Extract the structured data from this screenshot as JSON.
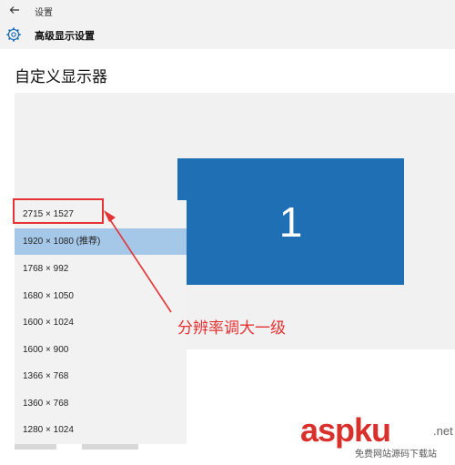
{
  "header": {
    "back_icon": "back-arrow-icon",
    "app_title": "设置",
    "page_icon": "gear-icon",
    "page_heading": "高级显示设置"
  },
  "main": {
    "section_title": "自定义显示器",
    "monitor_label": "1"
  },
  "resolution_dropdown": {
    "options": [
      "2715 × 1527",
      "1920 × 1080 (推荐)",
      "1768 × 992",
      "1680 × 1050",
      "1600 × 1024",
      "1600 × 900",
      "1366 × 768",
      "1360 × 768",
      "1280 × 1024"
    ],
    "selected": "1920 × 1080 (推荐)"
  },
  "annotation": {
    "text": "分辨率调大一级",
    "color": "#e53232"
  },
  "watermark": {
    "brand": "aspku",
    "suffix": ".net",
    "tagline": "免费网站源码下载站"
  },
  "colors": {
    "accent": "#1f6fb5",
    "selected_bg": "#a6c8e8",
    "highlight": "#e53232"
  }
}
